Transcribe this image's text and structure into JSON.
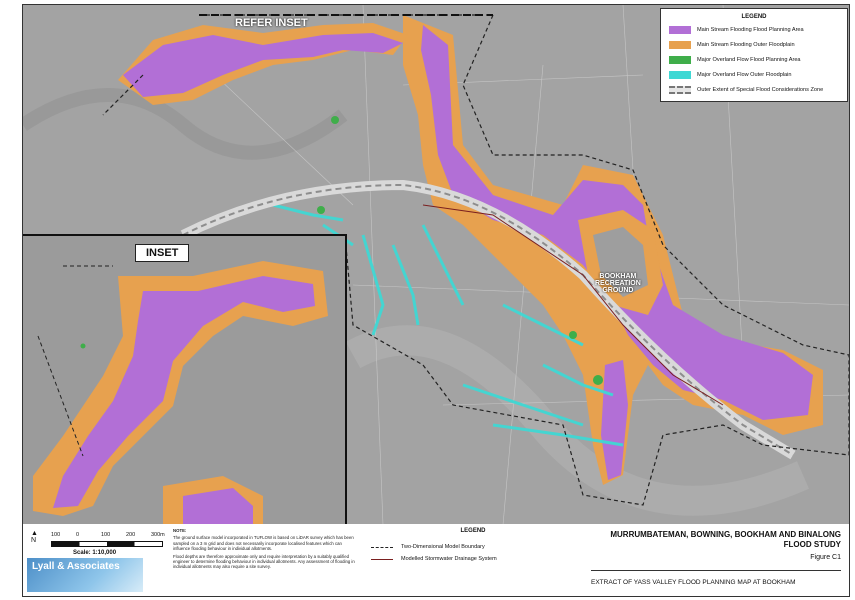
{
  "map": {
    "refer_inset_label": "REFER INSET",
    "recreation_ground_label": "BOOKHAM\nRECREATION\nGROUND",
    "inset": {
      "title": "INSET"
    },
    "legend": {
      "title": "LEGEND",
      "items": [
        {
          "label": "Main Stream Flooding Flood Planning Area",
          "color": "#b26fd6"
        },
        {
          "label": "Main Stream Flooding Outer Floodplain",
          "color": "#e7a14f"
        },
        {
          "label": "Major Overland Flow Flood Planning Area",
          "color": "#3fae4a"
        },
        {
          "label": "Major Overland Flow Outer Floodplain",
          "color": "#3fd8d4"
        },
        {
          "label": "Outer Extent of Special Flood Considerations Zone",
          "color": "#cfcfcf"
        }
      ]
    }
  },
  "footer": {
    "scale_labels": [
      "100",
      "0",
      "100",
      "200",
      "300m"
    ],
    "scale_text": "Scale: 1:10,000",
    "logo_text": "Lyall & Associates",
    "note_title": "NOTE:",
    "note_paragraphs": [
      "The ground surface model incorporated in TUFLOW is based on LiDAR survey which has been sampled on a 3 m grid and does not necessarily incorporate localised features which can influence flooding behaviour in individual allotments.",
      "Flood depths are therefore approximate only and require interpretation by a suitably qualified engineer to determine flooding behaviour in individual allotments. Any assessment of flooding in individual allotments may also require a site survey."
    ],
    "legend_title": "LEGEND",
    "legend_items": [
      {
        "label": "Two-Dimensional Model Boundary"
      },
      {
        "label": "Modelled Stormwater Drainage System"
      }
    ],
    "title": "MURRUMBATEMAN, BOWNING, BOOKHAM AND BINALONG FLOOD STUDY",
    "figure": "Figure C1",
    "extract": "EXTRACT OF YASS VALLEY FLOOD PLANNING MAP AT BOOKHAM"
  }
}
